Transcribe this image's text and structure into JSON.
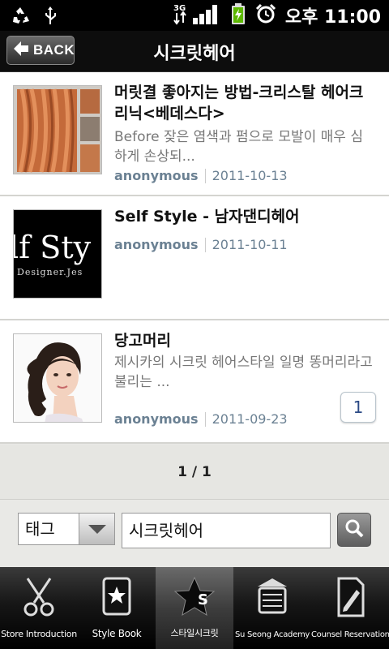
{
  "status_bar": {
    "time": "오후 11:00",
    "network_label": "3G",
    "icons": [
      "recycle-icon",
      "usb-icon",
      "signal-icon",
      "battery-charging-icon",
      "alarm-clock-icon"
    ]
  },
  "header": {
    "back_label": "BACK",
    "title": "시크릿헤어"
  },
  "posts": [
    {
      "title": "머릿결 좋아지는 방법-크리스탈 헤어크리닉<베데스다>",
      "excerpt": "Before 잦은 염색과 펌으로 모발이 매우 심하게 손상되...",
      "author": "anonymous",
      "date": "2011-10-13",
      "thumb_icon": "hair-photo-icon"
    },
    {
      "title": "Self Style - 남자댄디헤어",
      "excerpt": "",
      "author": "anonymous",
      "date": "2011-10-11",
      "thumb_text": "lf Sty",
      "thumb_subtext": "Designer.Jes"
    },
    {
      "title": "당고머리",
      "excerpt": "제시카의 시크릿 헤어스타일 일명 똥머리라고 불리는 ...",
      "author": "anonymous",
      "date": "2011-09-23",
      "comment_count": "1"
    }
  ],
  "pager": {
    "text": "1 / 1"
  },
  "search": {
    "filter_value": "태그",
    "query": "시크릿헤어"
  },
  "tabs": [
    {
      "label": "Store Introduction",
      "icon": "scissors-icon"
    },
    {
      "label": "Style Book",
      "icon": "star-book-icon"
    },
    {
      "label": "스타일시크릿",
      "icon": "star-s-icon",
      "active": true
    },
    {
      "label": "Su Seong Academy",
      "icon": "building-icon"
    },
    {
      "label": "Counsel Reservation",
      "icon": "pencil-note-icon"
    }
  ],
  "colors": {
    "meta_text": "#6b8193",
    "comment_count": "#2b4a85",
    "header_bg": "#0d0d0d"
  }
}
